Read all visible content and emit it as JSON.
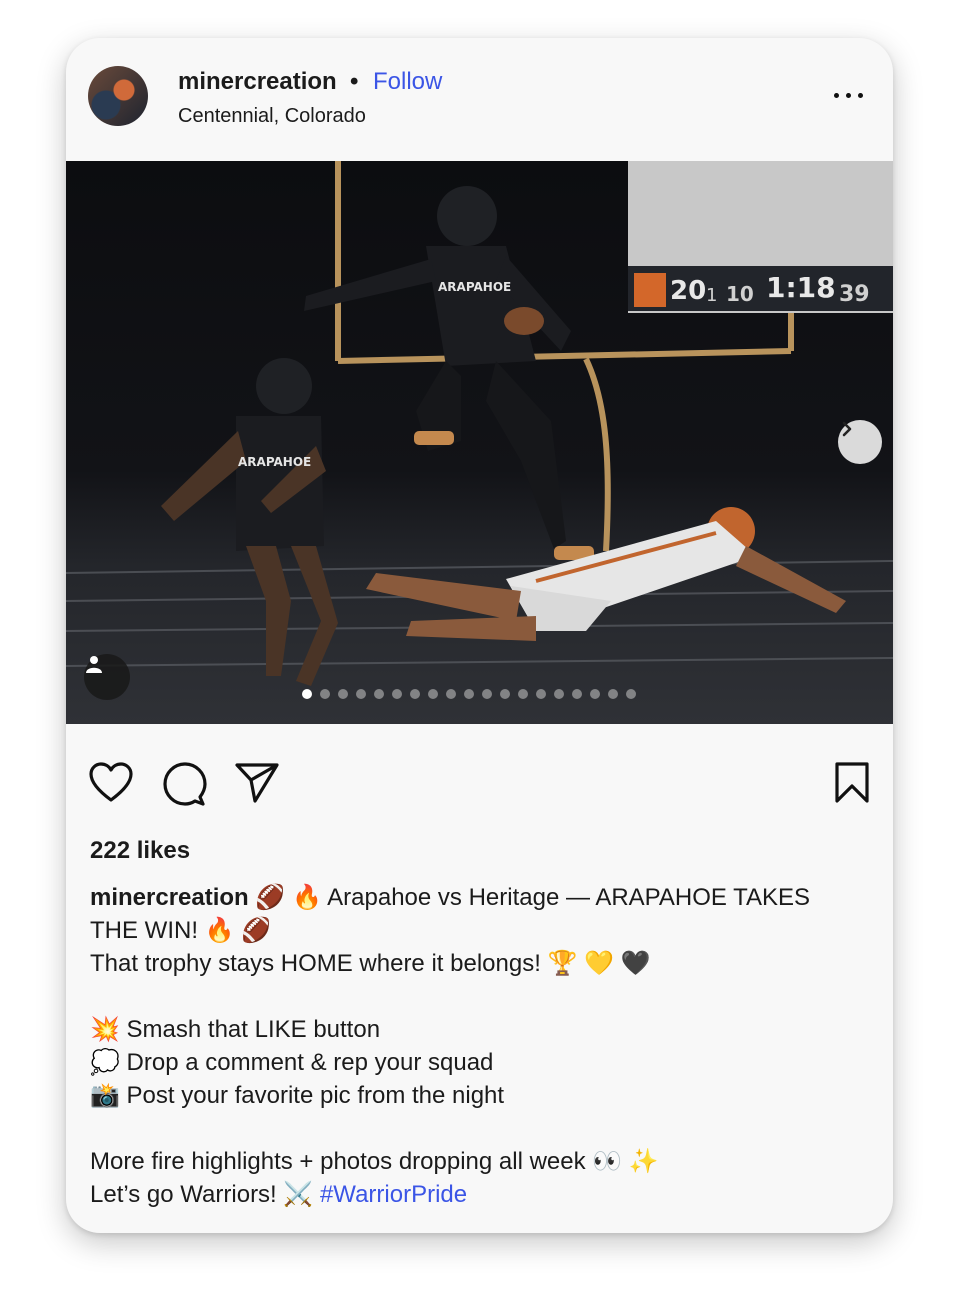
{
  "post": {
    "username": "minercreation",
    "separator": "•",
    "follow_label": "Follow",
    "location": "Centennial, Colorado",
    "more_icon": "more-horizontal-icon"
  },
  "media": {
    "scoreboard": {
      "home_score": "20",
      "quarter": "1",
      "down": "10",
      "clock": "1:18",
      "away_score": "39"
    },
    "jersey_front": "ARAPAHOE",
    "slide_count": 19,
    "active_slide": 0
  },
  "actions": {
    "like_icon": "heart-icon",
    "comment_icon": "comment-icon",
    "share_icon": "send-icon",
    "save_icon": "bookmark-icon"
  },
  "likes": "222 likes",
  "caption": {
    "username": "minercreation",
    "line1": " 🏈 🔥 Arapahoe vs Heritage — ARAPAHOE TAKES THE WIN! 🔥 🏈",
    "line2": "That trophy stays HOME where it belongs! 🏆 💛 🖤",
    "line3": "💥 Smash that LIKE button",
    "line4": "💭 Drop a comment & rep your squad",
    "line5": "📸 Post your favorite pic from the night",
    "line6": "More fire highlights + photos dropping all week 👀 ✨",
    "line7_text": "Let’s go Warriors! ⚔️ ",
    "hashtag": "#WarriorPride"
  }
}
